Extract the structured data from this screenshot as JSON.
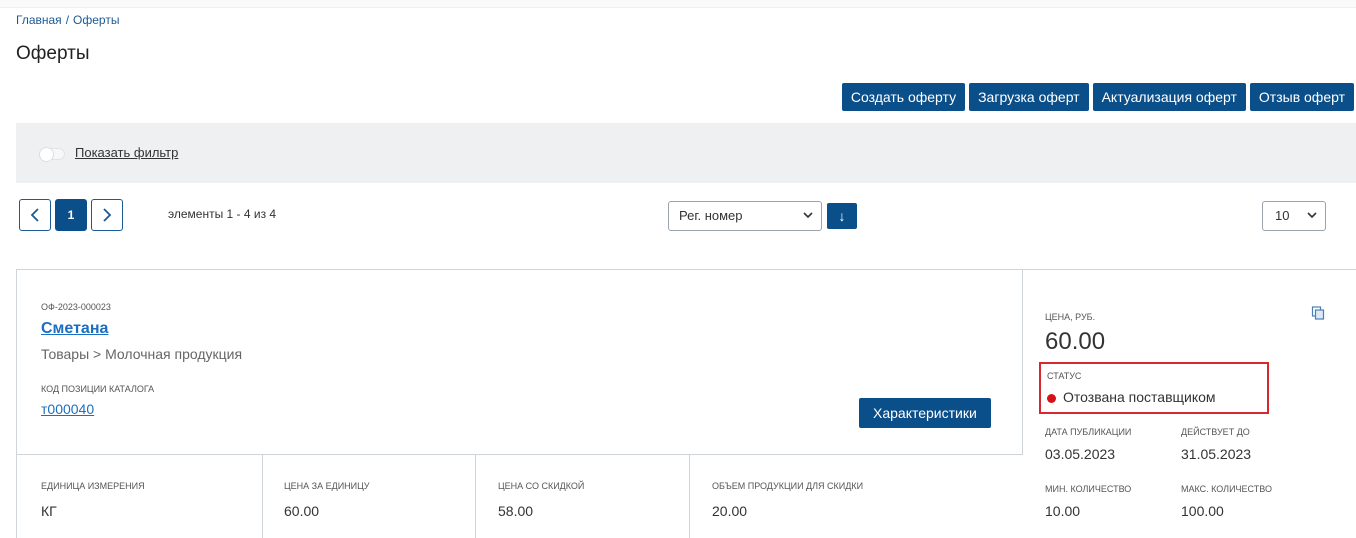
{
  "breadcrumb": {
    "home": "Главная",
    "separator": "/",
    "current": "Оферты"
  },
  "page": {
    "title": "Оферты"
  },
  "actions": {
    "create": "Создать оферту",
    "upload": "Загрузка оферт",
    "actualize": "Актуализация оферт",
    "withdraw": "Отзыв оферт"
  },
  "filter": {
    "toggle_label": "Показать фильтр",
    "enabled": false
  },
  "pagination": {
    "prev_icon": "chevron-left-icon",
    "current_page": "1",
    "next_icon": "chevron-right-icon",
    "info": "элементы 1 - 4 из 4"
  },
  "sort": {
    "selected": "Рег. номер",
    "direction_icon": "↓"
  },
  "per_page": {
    "selected": "10"
  },
  "offer": {
    "reg_number": "ОФ-2023-000023",
    "product_name": "Сметана",
    "category_path": "Товары > Молочная продукция",
    "catalog_code_label": "Код позиции каталога",
    "catalog_code": "т000040",
    "characteristics_button": "Характеристики",
    "unit_label": "Единица измерения",
    "unit": "КГ",
    "unit_price_label": "Цена за единицу",
    "unit_price": "60.00",
    "discount_price_label": "Цена со скидкой",
    "discount_price": "58.00",
    "discount_volume_label": "Объем продукции для скидки",
    "discount_volume": "20.00",
    "price_label": "Цена, руб.",
    "price": "60.00",
    "status_label": "Статус",
    "status": "Отозвана поставщиком",
    "status_color": "#d7111b",
    "published_label": "Дата публикации",
    "published": "03.05.2023",
    "valid_until_label": "Действует до",
    "valid_until": "31.05.2023",
    "min_qty_label": "Мин. количество",
    "min_qty": "10.00",
    "max_qty_label": "Макс. количество",
    "max_qty": "100.00"
  },
  "colors": {
    "primary": "#0b4f8a",
    "link": "#1a6fc1",
    "highlight": "#d7282f"
  }
}
